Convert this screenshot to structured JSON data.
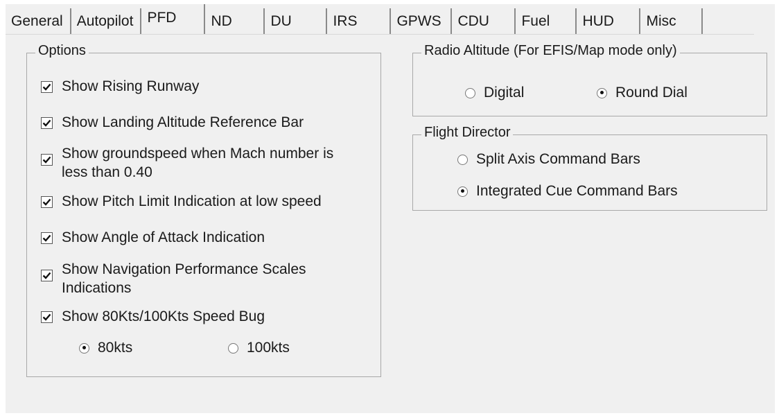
{
  "tabs": [
    "General",
    "Autopilot",
    "PFD",
    "ND",
    "DU",
    "IRS",
    "GPWS",
    "CDU",
    "Fuel",
    "HUD",
    "Misc"
  ],
  "active_tab": "PFD",
  "options": {
    "legend": "Options",
    "items": [
      {
        "label": "Show Rising Runway",
        "checked": true
      },
      {
        "label": "Show Landing Altitude Reference Bar",
        "checked": true
      },
      {
        "label": "Show groundspeed when Mach number is less than 0.40",
        "checked": true
      },
      {
        "label": "Show Pitch Limit Indication at low speed",
        "checked": true
      },
      {
        "label": "Show Angle of Attack Indication",
        "checked": true
      },
      {
        "label": "Show Navigation Performance Scales Indications",
        "checked": true
      },
      {
        "label": "Show 80Kts/100Kts Speed Bug",
        "checked": true
      }
    ],
    "speed_bug": {
      "opt1": "80kts",
      "opt2": "100kts",
      "selected": "80kts"
    }
  },
  "radio_altitude": {
    "legend": "Radio Altitude (For EFIS/Map mode only)",
    "opt1": "Digital",
    "opt2": "Round Dial",
    "selected": "Round Dial"
  },
  "flight_director": {
    "legend": "Flight Director",
    "opt1": "Split Axis Command Bars",
    "opt2": "Integrated Cue Command Bars",
    "selected": "Integrated Cue Command Bars"
  }
}
